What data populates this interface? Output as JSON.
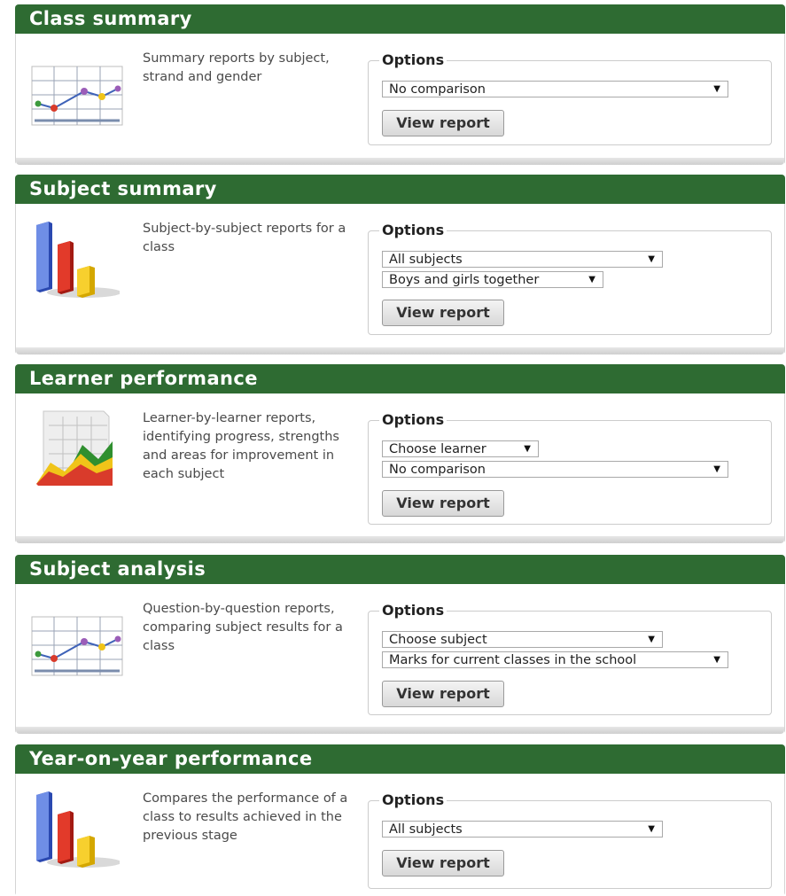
{
  "panels": [
    {
      "title": "Class summary",
      "icon": "line-chart-icon",
      "description": "Summary reports by subject, strand and gender",
      "options_label": "Options",
      "selects": [
        "No comparison"
      ],
      "button": "View report"
    },
    {
      "title": "Subject summary",
      "icon": "bar-chart-icon",
      "description": "Subject-by-subject reports for a class",
      "options_label": "Options",
      "selects": [
        "All subjects",
        "Boys and girls together"
      ],
      "button": "View report"
    },
    {
      "title": "Learner performance",
      "icon": "area-chart-icon",
      "description": "Learner-by-learner reports, identifying progress, strengths and areas for improvement in each subject",
      "options_label": "Options",
      "selects": [
        "Choose learner",
        "No comparison"
      ],
      "button": "View report"
    },
    {
      "title": "Subject analysis",
      "icon": "line-chart-icon",
      "description": "Question-by-question reports, comparing subject results for a class",
      "options_label": "Options",
      "selects": [
        "Choose subject",
        "Marks for current classes in the school"
      ],
      "button": "View report"
    },
    {
      "title": "Year-on-year performance",
      "icon": "bar-chart-icon",
      "description": "Compares the performance of a class to results achieved in the previous stage",
      "options_label": "Options",
      "selects": [
        "All subjects"
      ],
      "button": "View report"
    }
  ],
  "colors": {
    "header_bg": "#2e6b32",
    "header_text": "#ffffff"
  }
}
